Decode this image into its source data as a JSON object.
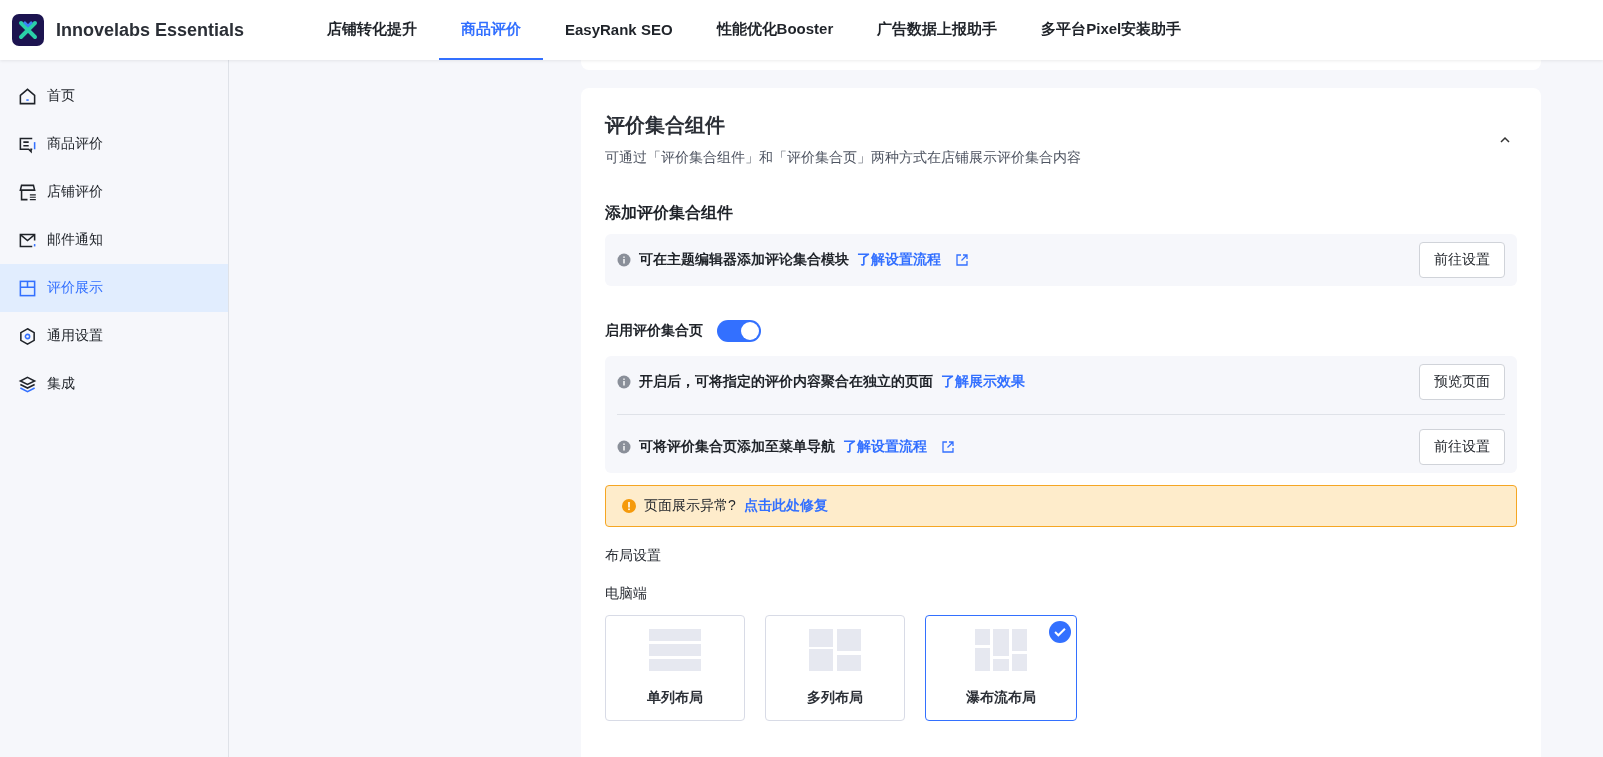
{
  "app": {
    "name": "Innovelabs Essentials"
  },
  "tabs": [
    {
      "label": "店铺转化提升",
      "selected": false
    },
    {
      "label": "商品评价",
      "selected": true
    },
    {
      "label": "EasyRank SEO",
      "selected": false
    },
    {
      "label": "性能优化Booster",
      "selected": false
    },
    {
      "label": "广告数据上报助手",
      "selected": false
    },
    {
      "label": "多平台Pixel安装助手",
      "selected": false
    }
  ],
  "sidebar": {
    "items": [
      {
        "label": "首页",
        "selected": false
      },
      {
        "label": "商品评价",
        "selected": false
      },
      {
        "label": "店铺评价",
        "selected": false
      },
      {
        "label": "邮件通知",
        "selected": false
      },
      {
        "label": "评价展示",
        "selected": true
      },
      {
        "label": "通用设置",
        "selected": false
      },
      {
        "label": "集成",
        "selected": false
      }
    ]
  },
  "section": {
    "title": "评价集合组件",
    "subtitle": "可通过「评价集合组件」和「评价集合页」两种方式在店铺展示评价集合内容",
    "expanded": true,
    "widget": {
      "heading": "添加评价集合组件",
      "rows": [
        {
          "text": "可在主题编辑器添加评论集合模块",
          "link": "了解设置流程",
          "external": true,
          "button": "前往设置"
        }
      ]
    },
    "page_toggle": {
      "label": "启用评价集合页",
      "on": true
    },
    "page_rows": [
      {
        "text": "开启后，可将指定的评价内容聚合在独立的页面",
        "link": "了解展示效果",
        "external": false,
        "button": "预览页面"
      },
      {
        "text": "可将评价集合页添加至菜单导航",
        "link": "了解设置流程",
        "external": true,
        "button": "前往设置"
      }
    ],
    "warning": {
      "text": "页面展示异常?",
      "link": "点击此处修复"
    },
    "layout_heading": "布局设置",
    "device_label": "电脑端",
    "layouts": [
      {
        "label": "单列布局",
        "kind": "single",
        "selected": false
      },
      {
        "label": "多列布局",
        "kind": "multi",
        "selected": false
      },
      {
        "label": "瀑布流布局",
        "kind": "waterfall",
        "selected": true
      }
    ]
  }
}
